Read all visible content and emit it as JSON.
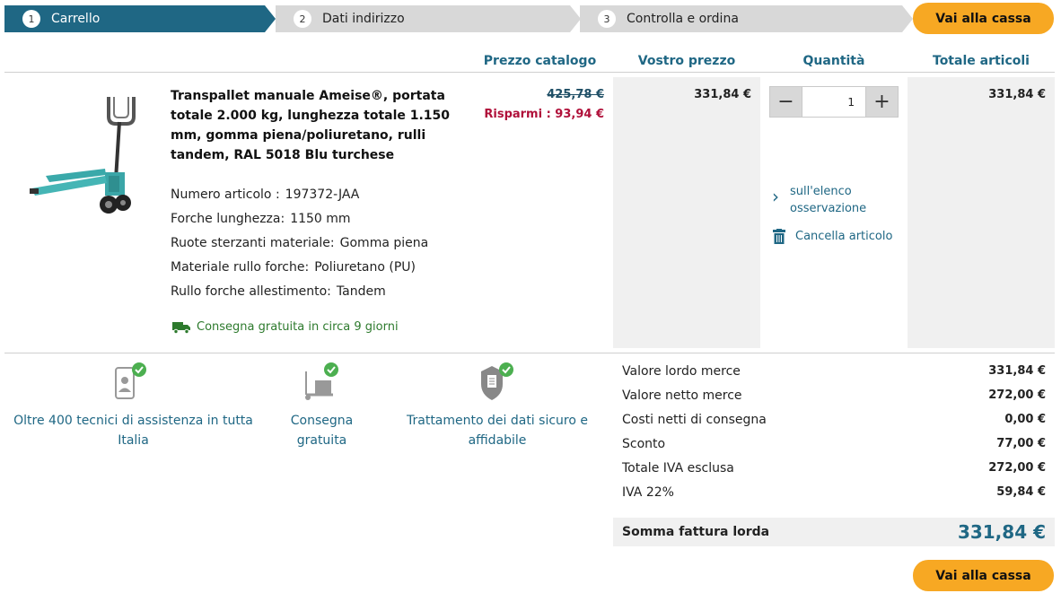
{
  "steps": [
    {
      "num": "1",
      "label": "Carrello"
    },
    {
      "num": "2",
      "label": "Dati indirizzo"
    },
    {
      "num": "3",
      "label": "Controlla e ordina"
    }
  ],
  "cta_label": "Vai alla cassa",
  "headers": {
    "list_price": "Prezzo catalogo",
    "your_price": "Vostro prezzo",
    "quantity": "Quantità",
    "total": "Totale articoli"
  },
  "product": {
    "title": "Transpallet manuale Ameise®, portata totale 2.000 kg, lunghezza totale 1.150 mm, gomma piena/poliuretano, rulli tandem, RAL 5018 Blu turchese",
    "attributes": [
      {
        "label": "Numero articolo :",
        "value": "197372-JAA"
      },
      {
        "label": "Forche lunghezza:",
        "value": "1150 mm"
      },
      {
        "label": "Ruote sterzanti materiale:",
        "value": "Gomma piena"
      },
      {
        "label": "Materiale rullo forche:",
        "value": "Poliuretano (PU)"
      },
      {
        "label": "Rullo forche allestimento:",
        "value": "Tandem"
      }
    ],
    "delivery": "Consegna gratuita in circa 9 giorni",
    "list_price": "425,78 €",
    "savings": "Risparmi : 93,94 €",
    "your_price": "331,84 €",
    "quantity": "1",
    "line_total": "331,84 €",
    "watchlist": "sull'elenco osservazione",
    "remove": "Cancella articolo"
  },
  "trust": [
    {
      "icon": "phone-support-icon",
      "text": "Oltre 400 tecnici di assistenza in tutta Italia"
    },
    {
      "icon": "pallet-truck-icon",
      "text": "Consegna gratuita"
    },
    {
      "icon": "shield-icon",
      "text": "Trattamento dei dati sicuro e affidabile"
    }
  ],
  "summary": [
    {
      "label": "Valore lordo merce",
      "value": "331,84 €"
    },
    {
      "label": "Valore netto merce",
      "value": "272,00 €"
    },
    {
      "label": "Costi netti di consegna",
      "value": "0,00 €"
    },
    {
      "label": "Sconto",
      "value": "77,00 €"
    },
    {
      "label": "Totale IVA esclusa",
      "value": "272,00 €"
    },
    {
      "label": "IVA 22%",
      "value": "59,84 €"
    }
  ],
  "grand_total": {
    "label": "Somma fattura lorda",
    "value": "331,84 €"
  },
  "colors": {
    "primary": "#1f6784",
    "cta": "#f7a823",
    "savings": "#b0103a",
    "delivery": "#2d7a2d"
  }
}
